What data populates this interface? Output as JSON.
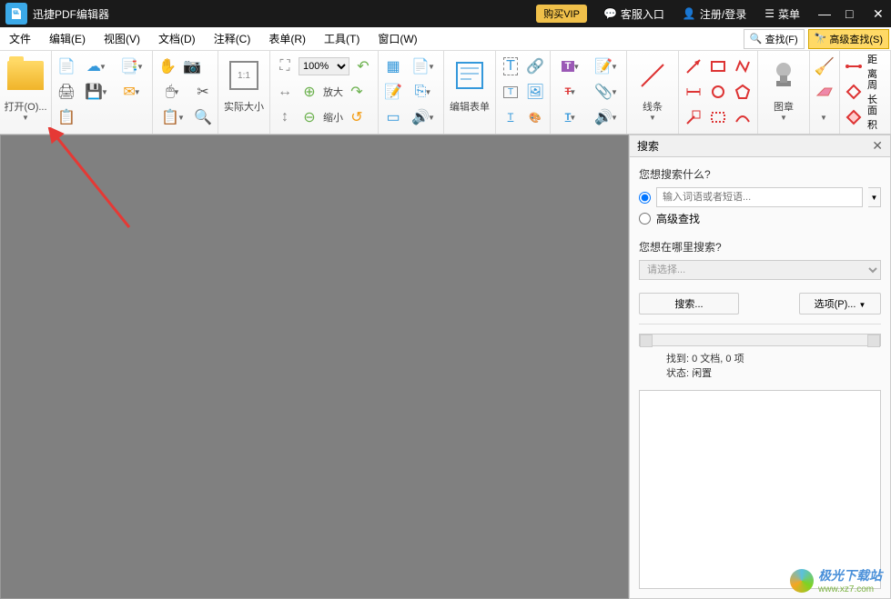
{
  "titlebar": {
    "app_name": "迅捷PDF编辑器",
    "vip_label": "购买VIP",
    "support_label": "客服入口",
    "login_label": "注册/登录",
    "menu_label": "菜单"
  },
  "menubar": {
    "file": "文件",
    "edit": "编辑(E)",
    "view": "视图(V)",
    "document": "文档(D)",
    "comment": "注释(C)",
    "form": "表单(R)",
    "tool": "工具(T)",
    "window": "窗口(W)",
    "find": "查找(F)",
    "advfind": "高级查找(S)"
  },
  "toolbar": {
    "open": "打开(O)...",
    "actual_size": "实际大小",
    "zoom_value": "100%",
    "zoom_in": "放大",
    "zoom_out": "缩小",
    "edit_form": "编辑表单",
    "lines": "线条",
    "stamp": "图章",
    "distance": "距离",
    "perimeter": "周长",
    "area": "面积"
  },
  "search": {
    "panel_title": "搜索",
    "q1": "您想搜索什么?",
    "input_placeholder": "输入词语或者短语...",
    "adv_label": "高级查找",
    "q2": "您想在哪里搜索?",
    "select_placeholder": "请选择...",
    "search_btn": "搜索...",
    "options_btn": "选项(P)...",
    "found_label": "找到:",
    "found_value": "0 文档, 0 项",
    "status_label": "状态:",
    "status_value": "闲置"
  },
  "watermark": {
    "name": "极光下载站",
    "url": "www.xz7.com"
  }
}
